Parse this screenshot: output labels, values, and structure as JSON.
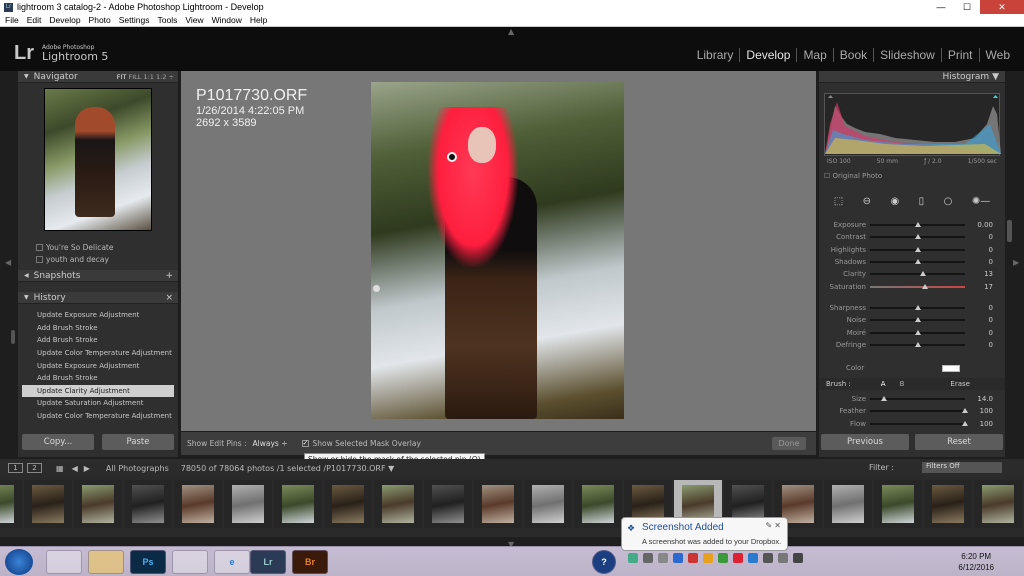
{
  "window": {
    "title": "lightroom 3 catalog-2 - Adobe Photoshop Lightroom - Develop",
    "min": "—",
    "max": "☐",
    "close": "✕"
  },
  "menu": [
    "File",
    "Edit",
    "Develop",
    "Photo",
    "Settings",
    "Tools",
    "View",
    "Window",
    "Help"
  ],
  "identity": {
    "adobe": "Adobe Photoshop",
    "product": "Lightroom 5",
    "lr": "Lr"
  },
  "modules": [
    "Library",
    "Develop",
    "Map",
    "Book",
    "Slideshow",
    "Print",
    "Web"
  ],
  "active_module": "Develop",
  "navigator": {
    "title": "Navigator",
    "fit": "FIT",
    "fill": "FILL",
    "one": "1:1",
    "ratio": "1:2 ÷"
  },
  "collections": [
    "You're So Delicate",
    "youth and decay"
  ],
  "snapshots": {
    "title": "Snapshots",
    "plus": "+"
  },
  "history": {
    "title": "History",
    "close": "×",
    "items": [
      "Update Exposure Adjustment",
      "Add Brush Stroke",
      "Add Brush Stroke",
      "Update Color Temperature Adjustment",
      "Update Exposure Adjustment",
      "Add Brush Stroke",
      "Update Clarity Adjustment",
      "Update Saturation Adjustment",
      "Update Color Temperature Adjustment"
    ],
    "selected_index": 6
  },
  "left_buttons": {
    "copy": "Copy...",
    "paste": "Paste"
  },
  "photo_info": {
    "filename": "P1017730.ORF",
    "datetime": "1/26/2014 4:22:05 PM",
    "dimensions": "2692 x 3589"
  },
  "toolbar": {
    "edit_pins_label": "Show Edit Pins :",
    "edit_pins_value": "Always ÷",
    "mask_overlay": "Show Selected Mask Overlay",
    "done": "Done",
    "tooltip": "Show or hide the mask of the selected pin (O)"
  },
  "histogram": {
    "title": "Histogram ▼",
    "iso": "ISO 100",
    "focal": "50 mm",
    "aperture": "ƒ / 2.0",
    "shutter": "1/500 sec",
    "original_photo": "Original Photo"
  },
  "sliders_a": [
    {
      "label": "Exposure",
      "value": "0.00",
      "pos": 0.5
    },
    {
      "label": "Contrast",
      "value": "0",
      "pos": 0.5
    },
    {
      "label": "Highlights",
      "value": "0",
      "pos": 0.5
    },
    {
      "label": "Shadows",
      "value": "0",
      "pos": 0.5
    },
    {
      "label": "Clarity",
      "value": "13",
      "pos": 0.56
    },
    {
      "label": "Saturation",
      "value": "17",
      "pos": 0.58
    }
  ],
  "sliders_b": [
    {
      "label": "Sharpness",
      "value": "0",
      "pos": 0.5
    },
    {
      "label": "Noise",
      "value": "0",
      "pos": 0.5
    },
    {
      "label": "Moiré",
      "value": "0",
      "pos": 0.5
    },
    {
      "label": "Defringe",
      "value": "0",
      "pos": 0.5
    }
  ],
  "color_label": "Color",
  "brush": {
    "label": "Brush :",
    "a": "A",
    "b": "B",
    "erase": "Erase"
  },
  "brush_sliders": [
    {
      "label": "Size",
      "value": "14.0",
      "pos": 0.15
    },
    {
      "label": "Feather",
      "value": "100",
      "pos": 1.0
    },
    {
      "label": "Flow",
      "value": "100",
      "pos": 1.0
    }
  ],
  "right_buttons": {
    "previous": "Previous",
    "reset": "Reset"
  },
  "filmstrip_bar": {
    "n1": "1",
    "n2": "2",
    "source": "All Photographs",
    "count": "78050 of 78064 photos /1 selected /P1017730.ORF ▼",
    "filter": "Filter :",
    "filter_value": "Filters Off"
  },
  "notification": {
    "title": "Screenshot Added",
    "body": "A screenshot was added to your Dropbox."
  },
  "clock": {
    "time": "6:20 PM",
    "date": "6/12/2016"
  },
  "taskbar_apps": [
    "",
    "",
    "",
    "Ps",
    "",
    "e",
    "Lr",
    "Br"
  ],
  "help_icon": "?"
}
